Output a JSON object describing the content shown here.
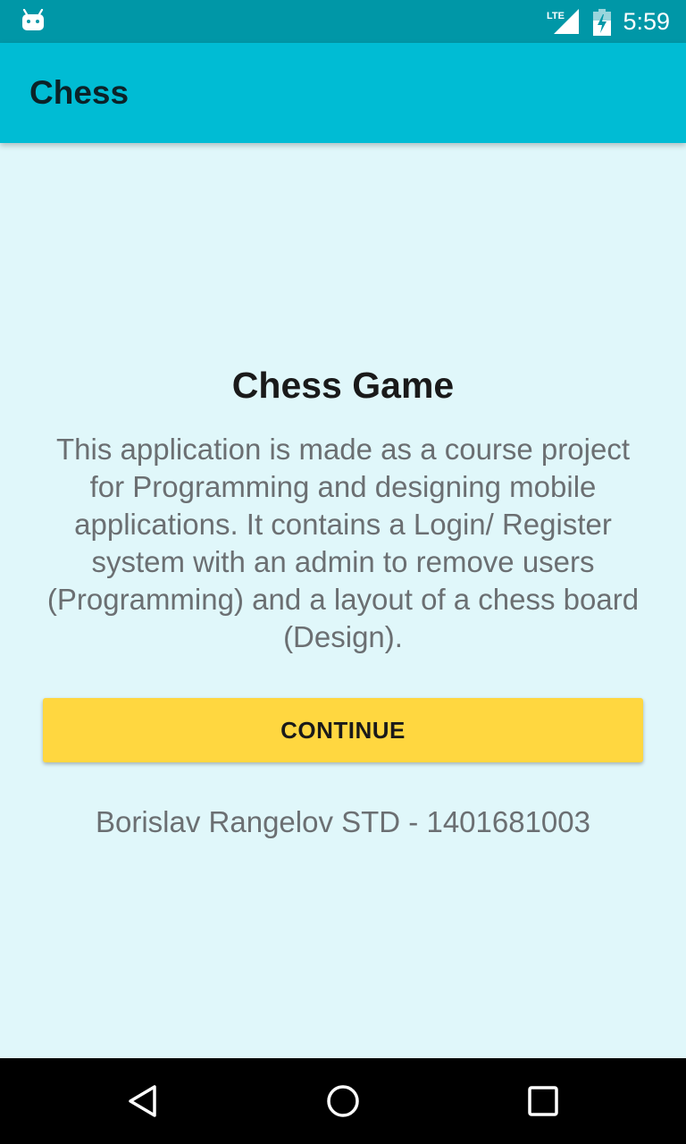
{
  "status_bar": {
    "network": "LTE",
    "time": "5:59",
    "icons": [
      "android-debug-icon",
      "lte-signal-icon",
      "battery-charging-icon"
    ]
  },
  "app_bar": {
    "title": "Chess"
  },
  "main": {
    "heading": "Chess Game",
    "description": "This application is made as a course project for Programming and designing mobile applications. It contains a Login/ Register system with an admin to remove users (Programming) and a layout of a chess board (Design).",
    "continue_label": "CONTINUE",
    "author": "Borislav Rangelov STD - 1401681003"
  },
  "nav_bar": {
    "icons": [
      "back-icon",
      "home-icon",
      "recents-icon"
    ]
  },
  "colors": {
    "status_bar": "#0097a7",
    "app_bar": "#00bcd4",
    "background": "#e0f7fa",
    "button": "#ffd740",
    "nav_bar": "#000000"
  }
}
